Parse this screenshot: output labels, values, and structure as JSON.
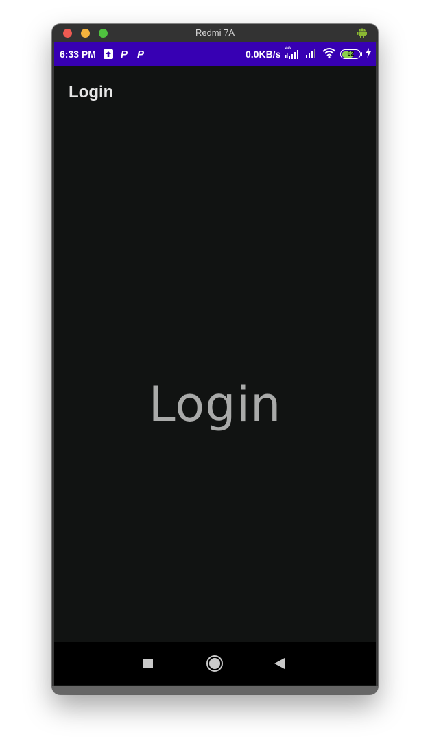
{
  "window": {
    "title": "Redmi 7A"
  },
  "statusbar": {
    "time": "6:33 PM",
    "speed": "0.0KB/s",
    "network_type": "4G",
    "battery": "62",
    "left_icons": [
      "upload-icon",
      "p-app-icon",
      "p-app-icon"
    ],
    "right_icons": [
      "signal-4g-icon",
      "signal-icon",
      "wifi-icon",
      "battery-icon",
      "charging-icon"
    ]
  },
  "appbar": {
    "title": "Login"
  },
  "main": {
    "center_text": "Login"
  },
  "navbar": {
    "buttons": [
      "recent-apps-button",
      "home-button",
      "back-button"
    ]
  },
  "colors": {
    "statusbar_bg": "#3700b3",
    "screen_bg": "#111312",
    "center_text": "#a9aaa9",
    "navbar_bg": "#000000"
  }
}
